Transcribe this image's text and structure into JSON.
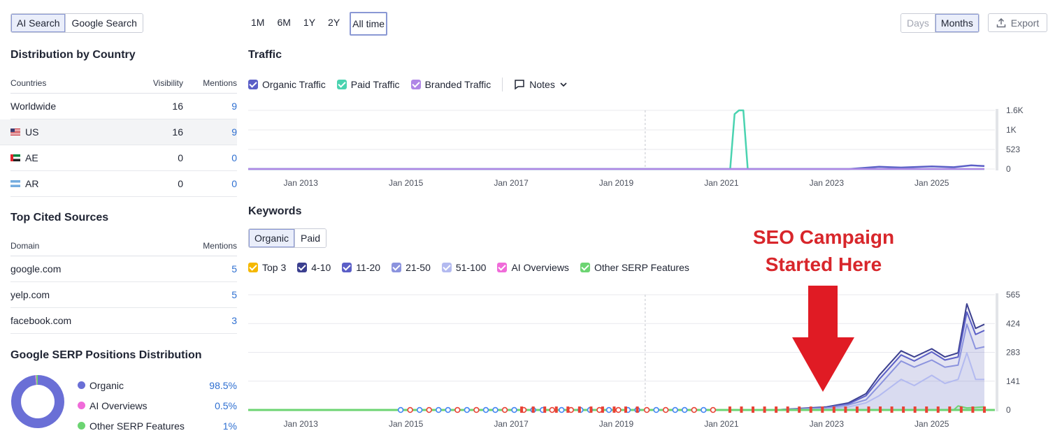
{
  "search_tabs": [
    "AI Search",
    "Google Search"
  ],
  "country": {
    "title": "Distribution by Country",
    "headers": {
      "name": "Countries",
      "visibility": "Visibility",
      "mentions": "Mentions"
    },
    "rows": [
      {
        "name": "Worldwide",
        "visibility": "16",
        "mentions": "9"
      },
      {
        "name": "US",
        "visibility": "16",
        "mentions": "9"
      },
      {
        "name": "AE",
        "visibility": "0",
        "mentions": "0"
      },
      {
        "name": "AR",
        "visibility": "0",
        "mentions": "0"
      }
    ]
  },
  "sources": {
    "title": "Top Cited Sources",
    "headers": {
      "domain": "Domain",
      "mentions": "Mentions"
    },
    "rows": [
      {
        "domain": "google.com",
        "mentions": "5"
      },
      {
        "domain": "yelp.com",
        "mentions": "5"
      },
      {
        "domain": "facebook.com",
        "mentions": "3"
      }
    ]
  },
  "serp": {
    "title": "Google SERP Positions Distribution",
    "items": [
      {
        "label": "Organic",
        "pct": "98.5%",
        "value": 98.5,
        "color": "#6a6fd6"
      },
      {
        "label": "AI Overviews",
        "pct": "0.5%",
        "value": 0.5,
        "color": "#f06bd9"
      },
      {
        "label": "Other SERP Features",
        "pct": "1%",
        "value": 1,
        "color": "#6cd472"
      }
    ]
  },
  "ranges": [
    "1M",
    "6M",
    "1Y",
    "2Y",
    "All time"
  ],
  "granularity": [
    "Days",
    "Months"
  ],
  "export_label": "Export",
  "traffic": {
    "title": "Traffic",
    "legend": [
      {
        "label": "Organic Traffic",
        "color": "#5b5fc7"
      },
      {
        "label": "Paid Traffic",
        "color": "#4ad3b0"
      },
      {
        "label": "Branded Traffic",
        "color": "#b086e6"
      }
    ],
    "notes_label": "Notes"
  },
  "keywords": {
    "title": "Keywords",
    "tabs": [
      "Organic",
      "Paid"
    ],
    "legend": [
      {
        "label": "Top 3",
        "color": "#f5b800"
      },
      {
        "label": "4-10",
        "color": "#3b3f8f"
      },
      {
        "label": "11-20",
        "color": "#5b5fc7"
      },
      {
        "label": "21-50",
        "color": "#8b93de"
      },
      {
        "label": "51-100",
        "color": "#b3baf0"
      },
      {
        "label": "AI Overviews",
        "color": "#f06bd9"
      },
      {
        "label": "Other SERP Features",
        "color": "#6cd472"
      }
    ]
  },
  "annotation": {
    "line1": "SEO Campaign",
    "line2": "Started Here",
    "color": "#d8262b"
  },
  "chart_data": [
    {
      "type": "line",
      "title": "Traffic",
      "x_ticks": [
        "Jan 2013",
        "Jan 2015",
        "Jan 2017",
        "Jan 2019",
        "Jan 2021",
        "Jan 2023",
        "Jan 2025"
      ],
      "y_ticks": [
        "1.6K",
        "1K",
        "523",
        "0"
      ],
      "ylim": [
        0,
        1600
      ],
      "series": [
        {
          "name": "Organic Traffic",
          "color": "#5b5fc7",
          "points": [
            [
              "2012-01",
              0
            ],
            [
              "2023-06",
              0
            ],
            [
              "2024-01",
              60
            ],
            [
              "2024-06",
              40
            ],
            [
              "2025-01",
              70
            ],
            [
              "2025-06",
              50
            ],
            [
              "2025-10",
              100
            ],
            [
              "2026-01",
              80
            ]
          ]
        },
        {
          "name": "Paid Traffic",
          "color": "#4ad3b0",
          "points": [
            [
              "2012-01",
              0
            ],
            [
              "2021-03",
              0
            ],
            [
              "2021-04",
              1500
            ],
            [
              "2021-05",
              1600
            ],
            [
              "2021-06",
              1600
            ],
            [
              "2021-07",
              0
            ],
            [
              "2026-01",
              0
            ]
          ]
        },
        {
          "name": "Branded Traffic",
          "color": "#b086e6",
          "points": [
            [
              "2012-01",
              0
            ],
            [
              "2026-01",
              0
            ]
          ]
        }
      ]
    },
    {
      "type": "area",
      "title": "Keywords",
      "x_ticks": [
        "Jan 2013",
        "Jan 2015",
        "Jan 2017",
        "Jan 2019",
        "Jan 2021",
        "Jan 2023",
        "Jan 2025"
      ],
      "y_ticks": [
        "565",
        "424",
        "283",
        "141",
        "0"
      ],
      "ylim": [
        0,
        565
      ],
      "series": [
        {
          "name": "4-10",
          "color": "#3b3f8f",
          "points": [
            [
              "2012-01",
              0
            ],
            [
              "2022-01",
              0
            ],
            [
              "2023-01",
              15
            ],
            [
              "2023-06",
              35
            ],
            [
              "2023-10",
              80
            ],
            [
              "2024-01",
              170
            ],
            [
              "2024-06",
              290
            ],
            [
              "2024-09",
              260
            ],
            [
              "2025-01",
              300
            ],
            [
              "2025-04",
              260
            ],
            [
              "2025-07",
              280
            ],
            [
              "2025-09",
              520
            ],
            [
              "2025-11",
              400
            ],
            [
              "2026-01",
              420
            ]
          ]
        },
        {
          "name": "11-20",
          "color": "#5b5fc7",
          "points": [
            [
              "2012-01",
              0
            ],
            [
              "2022-01",
              0
            ],
            [
              "2023-01",
              12
            ],
            [
              "2023-06",
              30
            ],
            [
              "2023-10",
              70
            ],
            [
              "2024-01",
              150
            ],
            [
              "2024-06",
              270
            ],
            [
              "2024-09",
              240
            ],
            [
              "2025-01",
              285
            ],
            [
              "2025-04",
              245
            ],
            [
              "2025-07",
              260
            ],
            [
              "2025-09",
              480
            ],
            [
              "2025-11",
              370
            ],
            [
              "2026-01",
              390
            ]
          ]
        },
        {
          "name": "21-50",
          "color": "#8b93de",
          "points": [
            [
              "2012-01",
              0
            ],
            [
              "2022-01",
              0
            ],
            [
              "2023-01",
              10
            ],
            [
              "2023-06",
              25
            ],
            [
              "2023-10",
              50
            ],
            [
              "2024-01",
              120
            ],
            [
              "2024-06",
              240
            ],
            [
              "2024-09",
              210
            ],
            [
              "2025-01",
              245
            ],
            [
              "2025-04",
              210
            ],
            [
              "2025-07",
              220
            ],
            [
              "2025-09",
              420
            ],
            [
              "2025-11",
              300
            ],
            [
              "2026-01",
              310
            ]
          ]
        },
        {
          "name": "51-100",
          "color": "#b3baf0",
          "points": [
            [
              "2012-01",
              0
            ],
            [
              "2022-01",
              0
            ],
            [
              "2023-01",
              5
            ],
            [
              "2023-06",
              15
            ],
            [
              "2023-10",
              35
            ],
            [
              "2024-01",
              70
            ],
            [
              "2024-06",
              150
            ],
            [
              "2024-09",
              120
            ],
            [
              "2025-01",
              170
            ],
            [
              "2025-04",
              130
            ],
            [
              "2025-07",
              150
            ],
            [
              "2025-09",
              280
            ],
            [
              "2025-11",
              150
            ],
            [
              "2026-01",
              150
            ]
          ]
        },
        {
          "name": "Other SERP Features",
          "color": "#6cd472",
          "points": [
            [
              "2012-01",
              0
            ],
            [
              "2025-06",
              0
            ],
            [
              "2025-07",
              20
            ],
            [
              "2025-09",
              10
            ],
            [
              "2026-01",
              15
            ]
          ]
        }
      ]
    }
  ]
}
